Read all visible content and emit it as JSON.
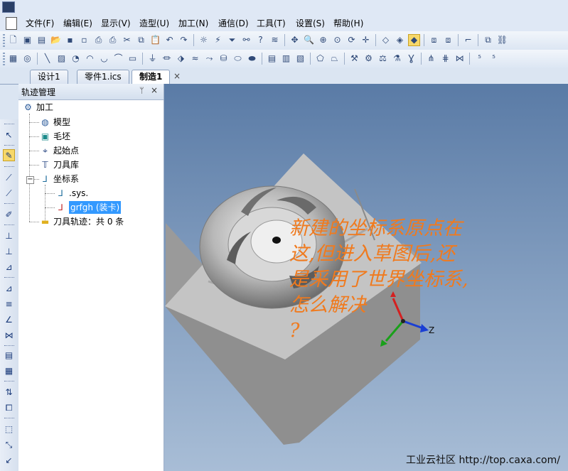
{
  "menu": {
    "items": [
      "文件(F)",
      "编辑(E)",
      "显示(V)",
      "造型(U)",
      "加工(N)",
      "通信(D)",
      "工具(T)",
      "设置(S)",
      "帮助(H)"
    ]
  },
  "tabs": [
    "设计1",
    "零件1.ics",
    "制造1"
  ],
  "tab_close": "×",
  "panel": {
    "title": "轨迹管理",
    "pin": "ᛘ",
    "close": "×",
    "tree": {
      "root": "加工",
      "model": "模型",
      "stock": "毛坯",
      "start_point": "起始点",
      "tool_library": "刀具库",
      "coord_system": "坐标系",
      "coord_sys": ".sys.",
      "coord_user": "grfgh (装卡)",
      "toolpath": "刀具轨迹：共 0 条"
    }
  },
  "viewport": {
    "annotation_lines": [
      "新建的坐标系原点在",
      "这,但进入草图后,还",
      "是采用了世界坐标系,",
      "怎么解决",
      "?"
    ],
    "axis_label": "Z",
    "watermark": "工业云社区 http://top.caxa.com/"
  },
  "colors": {
    "annotation": "#f07a1e",
    "selection": "#3399ff",
    "axis_x": "#d42020",
    "axis_y": "#1aa01a",
    "axis_z": "#1a3fd4"
  }
}
